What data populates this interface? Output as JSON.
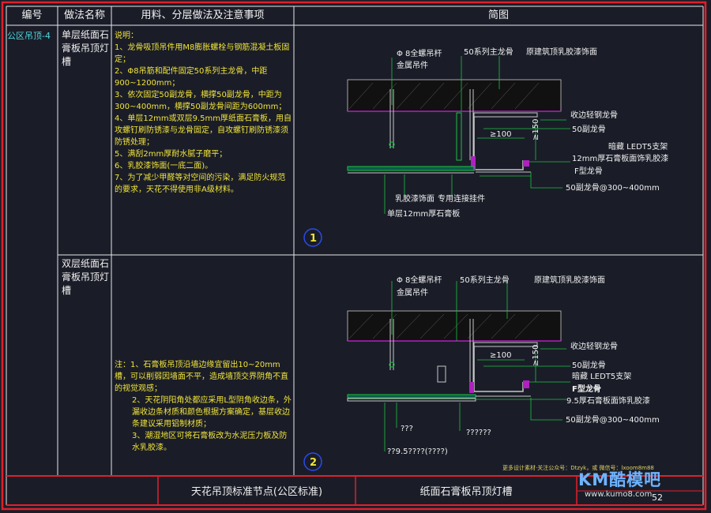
{
  "header": {
    "col_no": "编号",
    "col_method": "做法名称",
    "col_materials": "用料、分层做法及注意事项",
    "col_diagram": "简图"
  },
  "row1": {
    "code": "公区吊顶-4",
    "name": "单层纸面石膏板吊顶灯槽",
    "notes": [
      "说明：",
      "1、龙骨吸顶吊件用M8膨胀螺栓与钢筋混凝土板固定；",
      "2、Φ8吊筋和配件固定50系列主龙骨，中距900~1200mm；",
      "3、依次固定50副龙骨，横撑50副龙骨，中距为300~400mm，横撑50副龙骨间距为600mm；",
      "4、单层12mm或双层9.5mm厚纸面石膏板，用自攻螺钉刷防锈漆与龙骨固定，自攻螺钉刷防锈漆须防锈处理；",
      "5、满刮2mm厚耐水腻子磨平；",
      "6、乳胶漆饰面(一底二面)。",
      "7、为了减少甲醛等对空间的污染，满足防火规范的要求，天花不得使用非A级材料。"
    ]
  },
  "row2": {
    "name": "双层纸面石膏板吊顶灯槽",
    "notes": [
      "注：1、石膏板吊顶沿墙边缘宜留出10~20mm槽，可以削弱因墙面不平，造成墙顶交界阴角不直的视觉观感；",
      "2、天花阴阳角处都应采用L型阴角收边条，外漏收边条材质和颜色根据方案确定，基层收边条建议采用铝制材质；",
      "3、潮湿地区可将石膏板改为水泥压力板及防水乳胶漆。"
    ]
  },
  "diagram1": {
    "number": "1",
    "labels": {
      "rod": "Φ 8全螺吊杆",
      "hanger": "金属吊件",
      "main_keel": "50系列主龙骨",
      "slab": "原建筑顶乳胶漆饰面",
      "edge_keel": "收边轻钢龙骨",
      "sub_keel": "50副龙骨",
      "led": "暗藏 LEDT5支架",
      "board_paint": "12mm厚石膏板面饰乳胶漆",
      "f_keel": "F型龙骨",
      "sub_keel_spacing": "50副龙骨@300~400mm",
      "latex": "乳胶漆饰面",
      "connector": "专用连接挂件",
      "board": "单层12mm厚石膏板",
      "dim_100": "≥100",
      "dim_150": "≥150"
    }
  },
  "diagram2": {
    "number": "2",
    "labels": {
      "rod": "Φ 8全螺吊杆",
      "hanger": "金属吊件",
      "main_keel": "50系列主龙骨",
      "slab": "原建筑顶乳胶漆饰面",
      "edge_keel": "收边轻钢龙骨",
      "sub_keel": "50副龙骨",
      "led": "暗藏 LEDT5支架",
      "f_keel": "F型龙骨",
      "board_paint": "9.5厚石膏板面饰乳胶漆",
      "sub_keel_spacing": "50副龙骨@300~400mm",
      "q1": "???",
      "q2": "??????",
      "q3": "??9.5????(????)",
      "dim_100": "≥100",
      "dim_150": "≥150"
    }
  },
  "footer": {
    "title_left": "天花吊顶标准节点(公区标准)",
    "title_right": "纸面石膏板吊顶灯槽",
    "page": "52",
    "credit": "更多设计素材·关注公众号：Dtzyk，或 微信号：lxoom8m88",
    "logo": "KM酷模吧",
    "site": "www.kumo8.com"
  },
  "colors": {
    "background": "#1a1d28",
    "frame": "#e0202a",
    "grid": "#e8e8e8",
    "cyan_text": "#4cd7de",
    "yellow_text": "#f0e33a",
    "magenta": "#b020c0",
    "green": "#20c040"
  }
}
